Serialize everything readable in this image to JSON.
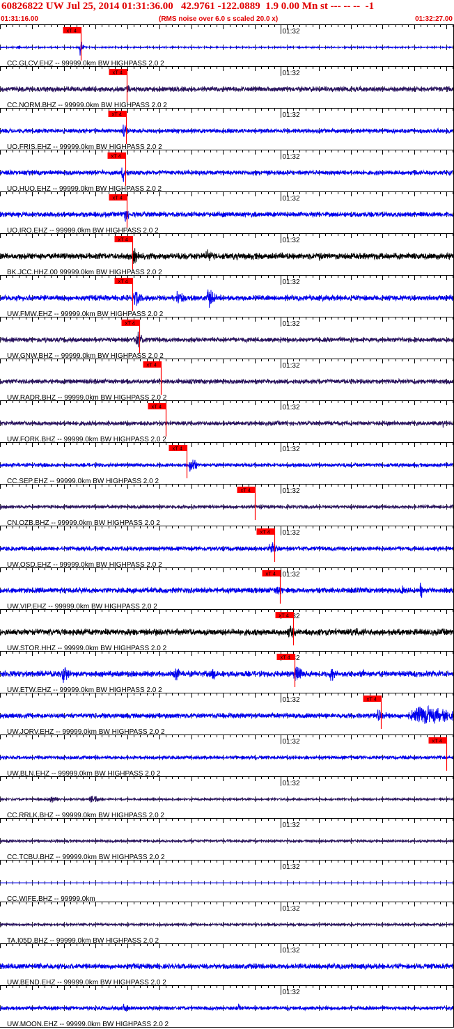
{
  "header": {
    "title": "60826822 UW Jul 25, 2014 01:31:36.00   42.9761 -122.0889  1.9 0.00 Mn st --- -- --  -1",
    "start_time": "01:31:16.00",
    "rms_note": "(RMS noise over 6.0 s scaled 20.0 x)",
    "end_time": "01:32:27.00"
  },
  "colors": {
    "title": "#e00000",
    "pick_marker": "#ff0000",
    "separator": "#000000",
    "blue": "#0000ee",
    "purple": "#2a1460",
    "black": "#000000"
  },
  "chart_data": {
    "type": "line",
    "title": "60826822 UW Jul 25, 2014 01:31:36.00   42.9761 -122.0889  1.9 0.00 Mn st --- -- --  -1",
    "x_unit": "seconds",
    "x_start": "01:31:16.00",
    "x_end": "01:32:27.00",
    "xlim": [
      0,
      71
    ],
    "minute_label": "01:32",
    "minute_label_offset_s": 44,
    "pick_label": "xT 4",
    "grid": false,
    "traces": [
      {
        "label": "CC.GLCV.EHZ -- 99999.0km BW  HIGHPASS  2.0  2",
        "color": "blue",
        "pick_s": 12.7,
        "noise": 0.06,
        "events": [
          [
            2.8,
            0.3,
            0.4
          ],
          [
            4.5,
            0.15,
            0.4
          ],
          [
            12.6,
            0.9,
            0.3
          ]
        ]
      },
      {
        "label": "CC.NORM.BHZ -- 99999.0km BW  HIGHPASS  2.0  2",
        "color": "purple",
        "pick_s": 19.9,
        "noise": 0.24,
        "events": [
          [
            20.0,
            0.55,
            0.6
          ]
        ]
      },
      {
        "label": "UO.FRIS.EHZ -- 99999.0km BW  HIGHPASS  2.0  2",
        "color": "blue",
        "pick_s": 19.8,
        "noise": 0.2,
        "events": [
          [
            19.4,
            0.95,
            0.4
          ]
        ]
      },
      {
        "label": "UO.HUO.EHZ -- 99999.0km BW  HIGHPASS  2.0  2",
        "color": "blue",
        "pick_s": 19.7,
        "noise": 0.22,
        "events": [
          [
            19.3,
            0.95,
            0.5
          ]
        ]
      },
      {
        "label": "UO.IRO.EHZ -- 99999.0km BW  HIGHPASS  2.0  2",
        "color": "blue",
        "pick_s": 19.9,
        "noise": 0.24,
        "events": [
          [
            19.5,
            0.95,
            0.6
          ]
        ]
      },
      {
        "label": "BK.JCC.HHZ.00 99999.0km BW  HIGHPASS  2.0  2",
        "color": "black",
        "pick_s": 20.8,
        "noise": 0.3,
        "events": [
          [
            21.0,
            0.9,
            0.7
          ],
          [
            32.5,
            0.7,
            0.8
          ],
          [
            50.0,
            0.5,
            0.8
          ]
        ]
      },
      {
        "label": "UW.FMW.EHZ -- 99999.0km BW  HIGHPASS  2.0  2",
        "color": "blue",
        "pick_s": 20.8,
        "noise": 0.26,
        "events": [
          [
            21.2,
            1.0,
            0.8
          ],
          [
            28.0,
            0.95,
            0.8
          ],
          [
            32.8,
            0.95,
            0.9
          ]
        ]
      },
      {
        "label": "UW.GNW.BHZ -- 99999.0km BW  HIGHPASS  2.0  2",
        "color": "purple",
        "pick_s": 21.9,
        "noise": 0.22,
        "events": [
          [
            21.5,
            0.85,
            1.0
          ],
          [
            44.0,
            0.3,
            0.6
          ],
          [
            57.0,
            0.3,
            0.6
          ]
        ]
      },
      {
        "label": "UW.RADR.BHZ -- 99999.0km BW  HIGHPASS  2.0  2",
        "color": "purple",
        "pick_s": 25.2,
        "noise": 0.22,
        "events": [
          [
            39.0,
            0.2,
            0.5
          ]
        ]
      },
      {
        "label": "UW.FORK.BHZ -- 99999.0km BW  HIGHPASS  2.0  2",
        "color": "purple",
        "pick_s": 26.0,
        "noise": 0.2,
        "events": [
          [
            17.0,
            0.5,
            0.15
          ],
          [
            39.0,
            0.4,
            0.2
          ],
          [
            69.5,
            0.5,
            0.15
          ]
        ]
      },
      {
        "label": "CC.SEP.EHZ -- 99999.0km BW  HIGHPASS  2.0  2",
        "color": "blue",
        "pick_s": 29.3,
        "noise": 0.18,
        "events": [
          [
            30.0,
            0.85,
            0.8
          ]
        ]
      },
      {
        "label": "CN.OZB.BHZ -- 99999.0km BW  HIGHPASS  2.0  2",
        "color": "purple",
        "pick_s": 40.0,
        "noise": 0.16,
        "events": [
          [
            41.0,
            0.25,
            0.6
          ]
        ]
      },
      {
        "label": "UW.OSD.EHZ -- 99999.0km BW  HIGHPASS  2.0  2",
        "color": "blue",
        "pick_s": 43.0,
        "noise": 0.2,
        "events": [
          [
            42.5,
            0.7,
            1.0
          ]
        ]
      },
      {
        "label": "UW.VIP.EHZ -- 99999.0km BW  HIGHPASS  2.0  2",
        "color": "blue",
        "pick_s": 43.9,
        "noise": 0.26,
        "events": [
          [
            43.5,
            0.55,
            1.2
          ],
          [
            63.0,
            0.55,
            0.8
          ],
          [
            66.0,
            1.0,
            0.3
          ]
        ]
      },
      {
        "label": "UW.STOR.HHZ -- 99999.0km BW  HIGHPASS  2.0  2",
        "color": "black",
        "pick_s": 46.0,
        "noise": 0.3,
        "events": [
          [
            45.5,
            0.7,
            0.9
          ],
          [
            50.0,
            0.5,
            0.6
          ],
          [
            56.0,
            0.5,
            0.5
          ],
          [
            64.0,
            0.45,
            0.5
          ]
        ]
      },
      {
        "label": "UW.ETW.EHZ -- 99999.0km BW  HIGHPASS  2.0  2",
        "color": "blue",
        "pick_s": 46.2,
        "noise": 0.28,
        "events": [
          [
            10.0,
            0.95,
            0.8
          ],
          [
            27.5,
            0.8,
            0.8
          ],
          [
            33.5,
            0.7,
            0.8
          ],
          [
            46.5,
            1.0,
            0.9
          ],
          [
            52.0,
            0.7,
            0.9
          ],
          [
            57.0,
            0.6,
            0.5
          ]
        ]
      },
      {
        "label": "UW.JORV.EHZ -- 99999.0km BW  HIGHPASS  2.0  2",
        "color": "blue",
        "pick_s": 59.8,
        "noise": 0.24,
        "events": [
          [
            59.5,
            0.7,
            1.0
          ],
          [
            66.5,
            1.0,
            4.5
          ]
        ]
      },
      {
        "label": "UW.BLN.EHZ -- 99999.0km BW  HIGHPASS  2.0  2",
        "color": "blue",
        "pick_s": 70.0,
        "noise": 0.16,
        "events": []
      },
      {
        "label": "CC.RRLK.BHZ -- 99999.0km BW  HIGHPASS  2.0  2",
        "color": "purple",
        "pick_s": null,
        "noise": 0.1,
        "events": [
          [
            8.0,
            0.35,
            1.2
          ],
          [
            14.5,
            0.55,
            1.0
          ]
        ]
      },
      {
        "label": "CC.TCBU.BHZ -- 99999.0km BW  HIGHPASS  2.0  2",
        "color": "purple",
        "pick_s": null,
        "noise": 0.12,
        "events": [
          [
            1.5,
            0.25,
            0.8
          ]
        ]
      },
      {
        "label": "CC.WIFE.BHZ -- 99999.0km",
        "color": "blue",
        "pick_s": null,
        "noise": 0.0,
        "events": []
      },
      {
        "label": "TA.I05D.BHZ -- 99999.0km BW  HIGHPASS  2.0  2",
        "color": "purple",
        "pick_s": null,
        "noise": 0.12,
        "events": []
      },
      {
        "label": "UW.BEND.EHZ -- 99999.0km BW  HIGHPASS  2.0  2",
        "color": "blue",
        "pick_s": null,
        "noise": 0.26,
        "events": [
          [
            25.0,
            0.3,
            2.0
          ]
        ]
      },
      {
        "label": "UW.MOON.EHZ -- 99999.0km BW  HIGHPASS  2.0  2",
        "color": "blue",
        "pick_s": null,
        "noise": 0.18,
        "events": [
          [
            19.5,
            0.45,
            0.8
          ],
          [
            37.5,
            0.5,
            0.3
          ]
        ]
      }
    ]
  }
}
